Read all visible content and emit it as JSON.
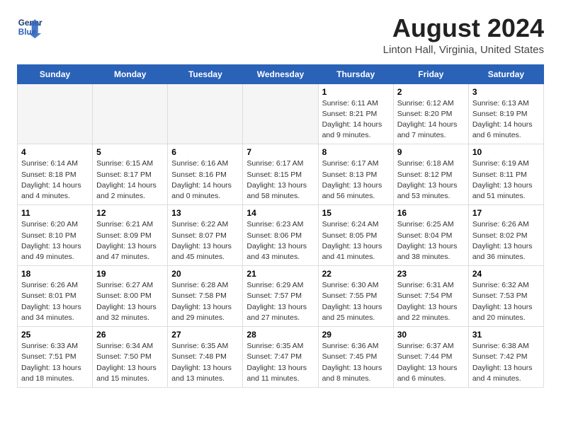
{
  "header": {
    "logo_line1": "General",
    "logo_line2": "Blue",
    "title": "August 2024",
    "subtitle": "Linton Hall, Virginia, United States"
  },
  "weekdays": [
    "Sunday",
    "Monday",
    "Tuesday",
    "Wednesday",
    "Thursday",
    "Friday",
    "Saturday"
  ],
  "weeks": [
    [
      {
        "day": "",
        "info": ""
      },
      {
        "day": "",
        "info": ""
      },
      {
        "day": "",
        "info": ""
      },
      {
        "day": "",
        "info": ""
      },
      {
        "day": "1",
        "info": "Sunrise: 6:11 AM\nSunset: 8:21 PM\nDaylight: 14 hours\nand 9 minutes."
      },
      {
        "day": "2",
        "info": "Sunrise: 6:12 AM\nSunset: 8:20 PM\nDaylight: 14 hours\nand 7 minutes."
      },
      {
        "day": "3",
        "info": "Sunrise: 6:13 AM\nSunset: 8:19 PM\nDaylight: 14 hours\nand 6 minutes."
      }
    ],
    [
      {
        "day": "4",
        "info": "Sunrise: 6:14 AM\nSunset: 8:18 PM\nDaylight: 14 hours\nand 4 minutes."
      },
      {
        "day": "5",
        "info": "Sunrise: 6:15 AM\nSunset: 8:17 PM\nDaylight: 14 hours\nand 2 minutes."
      },
      {
        "day": "6",
        "info": "Sunrise: 6:16 AM\nSunset: 8:16 PM\nDaylight: 14 hours\nand 0 minutes."
      },
      {
        "day": "7",
        "info": "Sunrise: 6:17 AM\nSunset: 8:15 PM\nDaylight: 13 hours\nand 58 minutes."
      },
      {
        "day": "8",
        "info": "Sunrise: 6:17 AM\nSunset: 8:13 PM\nDaylight: 13 hours\nand 56 minutes."
      },
      {
        "day": "9",
        "info": "Sunrise: 6:18 AM\nSunset: 8:12 PM\nDaylight: 13 hours\nand 53 minutes."
      },
      {
        "day": "10",
        "info": "Sunrise: 6:19 AM\nSunset: 8:11 PM\nDaylight: 13 hours\nand 51 minutes."
      }
    ],
    [
      {
        "day": "11",
        "info": "Sunrise: 6:20 AM\nSunset: 8:10 PM\nDaylight: 13 hours\nand 49 minutes."
      },
      {
        "day": "12",
        "info": "Sunrise: 6:21 AM\nSunset: 8:09 PM\nDaylight: 13 hours\nand 47 minutes."
      },
      {
        "day": "13",
        "info": "Sunrise: 6:22 AM\nSunset: 8:07 PM\nDaylight: 13 hours\nand 45 minutes."
      },
      {
        "day": "14",
        "info": "Sunrise: 6:23 AM\nSunset: 8:06 PM\nDaylight: 13 hours\nand 43 minutes."
      },
      {
        "day": "15",
        "info": "Sunrise: 6:24 AM\nSunset: 8:05 PM\nDaylight: 13 hours\nand 41 minutes."
      },
      {
        "day": "16",
        "info": "Sunrise: 6:25 AM\nSunset: 8:04 PM\nDaylight: 13 hours\nand 38 minutes."
      },
      {
        "day": "17",
        "info": "Sunrise: 6:26 AM\nSunset: 8:02 PM\nDaylight: 13 hours\nand 36 minutes."
      }
    ],
    [
      {
        "day": "18",
        "info": "Sunrise: 6:26 AM\nSunset: 8:01 PM\nDaylight: 13 hours\nand 34 minutes."
      },
      {
        "day": "19",
        "info": "Sunrise: 6:27 AM\nSunset: 8:00 PM\nDaylight: 13 hours\nand 32 minutes."
      },
      {
        "day": "20",
        "info": "Sunrise: 6:28 AM\nSunset: 7:58 PM\nDaylight: 13 hours\nand 29 minutes."
      },
      {
        "day": "21",
        "info": "Sunrise: 6:29 AM\nSunset: 7:57 PM\nDaylight: 13 hours\nand 27 minutes."
      },
      {
        "day": "22",
        "info": "Sunrise: 6:30 AM\nSunset: 7:55 PM\nDaylight: 13 hours\nand 25 minutes."
      },
      {
        "day": "23",
        "info": "Sunrise: 6:31 AM\nSunset: 7:54 PM\nDaylight: 13 hours\nand 22 minutes."
      },
      {
        "day": "24",
        "info": "Sunrise: 6:32 AM\nSunset: 7:53 PM\nDaylight: 13 hours\nand 20 minutes."
      }
    ],
    [
      {
        "day": "25",
        "info": "Sunrise: 6:33 AM\nSunset: 7:51 PM\nDaylight: 13 hours\nand 18 minutes."
      },
      {
        "day": "26",
        "info": "Sunrise: 6:34 AM\nSunset: 7:50 PM\nDaylight: 13 hours\nand 15 minutes."
      },
      {
        "day": "27",
        "info": "Sunrise: 6:35 AM\nSunset: 7:48 PM\nDaylight: 13 hours\nand 13 minutes."
      },
      {
        "day": "28",
        "info": "Sunrise: 6:35 AM\nSunset: 7:47 PM\nDaylight: 13 hours\nand 11 minutes."
      },
      {
        "day": "29",
        "info": "Sunrise: 6:36 AM\nSunset: 7:45 PM\nDaylight: 13 hours\nand 8 minutes."
      },
      {
        "day": "30",
        "info": "Sunrise: 6:37 AM\nSunset: 7:44 PM\nDaylight: 13 hours\nand 6 minutes."
      },
      {
        "day": "31",
        "info": "Sunrise: 6:38 AM\nSunset: 7:42 PM\nDaylight: 13 hours\nand 4 minutes."
      }
    ]
  ]
}
